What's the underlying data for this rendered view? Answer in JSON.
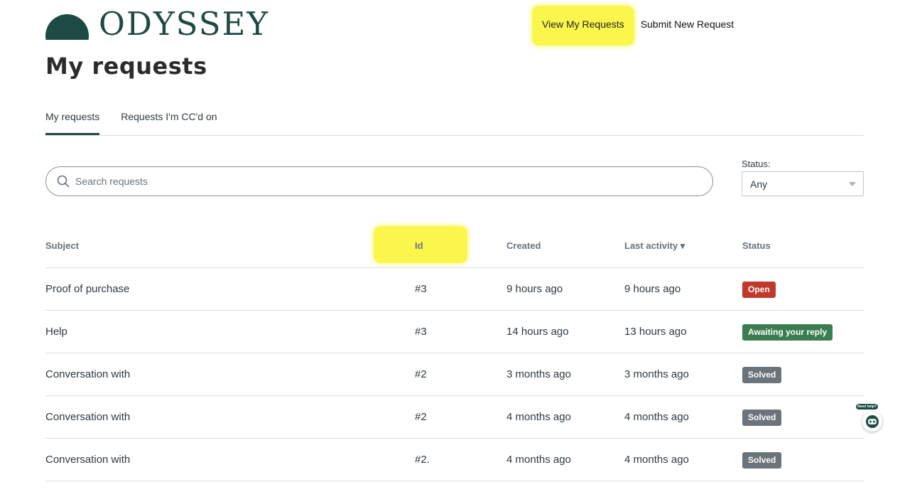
{
  "brand": {
    "name": "ODYSSEY",
    "color": "#1d4a44"
  },
  "nav": {
    "view_requests": "View My Requests",
    "submit_request": "Submit New Request"
  },
  "page": {
    "title": "My requests"
  },
  "tabs": [
    {
      "label": "My requests",
      "active": true
    },
    {
      "label": "Requests I'm CC'd on",
      "active": false
    }
  ],
  "search": {
    "placeholder": "Search requests",
    "value": ""
  },
  "status_filter": {
    "label": "Status:",
    "selected": "Any"
  },
  "table": {
    "headers": {
      "subject": "Subject",
      "id": "Id",
      "created": "Created",
      "last_activity": "Last activity ▾",
      "status": "Status"
    },
    "rows": [
      {
        "subject": "Proof of purchase",
        "id": "#3",
        "created": "9 hours ago",
        "last_activity": "9 hours ago",
        "status": "Open",
        "status_color": "#c0392b"
      },
      {
        "subject": "Help",
        "id": "#3",
        "created": "14 hours ago",
        "last_activity": "13 hours ago",
        "status": "Awaiting your reply",
        "status_color": "#3a7d4f"
      },
      {
        "subject": "Conversation with",
        "id": "#2",
        "created": "3 months ago",
        "last_activity": "3 months ago",
        "status": "Solved",
        "status_color": "#6b737b"
      },
      {
        "subject": "Conversation with",
        "id": "#2",
        "created": "4 months ago",
        "last_activity": "4 months ago",
        "status": "Solved",
        "status_color": "#6b737b"
      },
      {
        "subject": "Conversation with",
        "id": "#2.",
        "created": "4 months ago",
        "last_activity": "4 months ago",
        "status": "Solved",
        "status_color": "#6b737b"
      }
    ]
  },
  "help_widget": {
    "label": "Need help?"
  },
  "highlight_color": "#fbf64c"
}
